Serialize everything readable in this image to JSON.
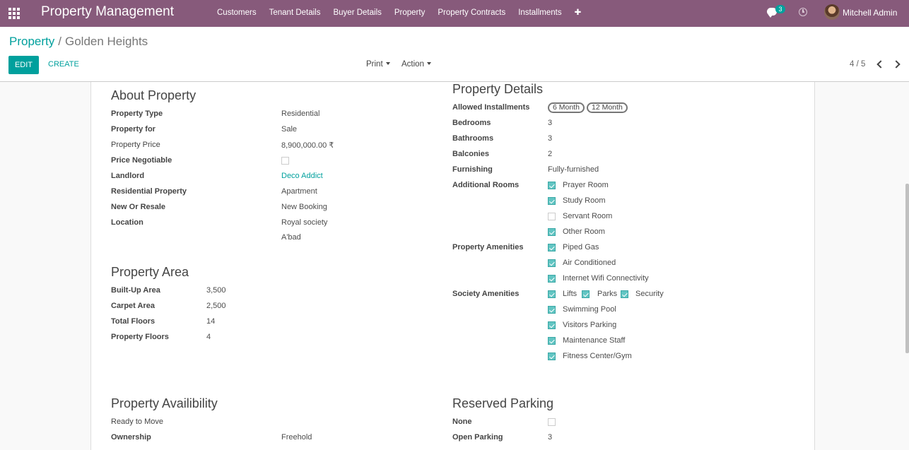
{
  "app_title": "Property Management",
  "menu": [
    "Customers",
    "Tenant Details",
    "Buyer Details",
    "Property",
    "Property Contracts",
    "Installments"
  ],
  "menu_plus": "✚",
  "messages_count": "3",
  "user_name": "Mitchell Admin",
  "colors": {
    "navbar": "#875a7b",
    "accent": "#00a09d",
    "checkbox_checked": "#62c5c3"
  },
  "breadcrumb": {
    "parent": "Property",
    "separator": "/",
    "current": "Golden Heights"
  },
  "buttons": {
    "edit": "EDIT",
    "create": "CREATE",
    "print": "Print",
    "action": "Action"
  },
  "pager": {
    "text": "4 / 5"
  },
  "about": {
    "title": "About Property",
    "fields": [
      {
        "label": "Property Type",
        "value": "Residential"
      },
      {
        "label": "Property for",
        "value": "Sale"
      },
      {
        "label": "Property Price",
        "value": "8,900,000.00 ₹"
      },
      {
        "label": "Price Negotiable",
        "checked": false
      },
      {
        "label": "Landlord",
        "value": "Deco Addict"
      },
      {
        "label": "Residential Property",
        "value": "Apartment"
      },
      {
        "label": "New Or Resale",
        "value": "New Booking"
      },
      {
        "label": "Location",
        "value": "Royal society",
        "value2": "A'bad"
      }
    ]
  },
  "area": {
    "title": "Property Area",
    "fields": [
      {
        "label": "Built-Up Area",
        "value": "3,500"
      },
      {
        "label": "Carpet Area",
        "value": "2,500"
      },
      {
        "label": "Total Floors",
        "value": "14"
      },
      {
        "label": "Property Floors",
        "value": "4"
      }
    ]
  },
  "details": {
    "title": "Property Details",
    "installments_label": "Allowed Installments",
    "installments": [
      "6 Month",
      "12 Month"
    ],
    "fields": [
      {
        "label": "Bedrooms",
        "value": "3"
      },
      {
        "label": "Bathrooms",
        "value": "3"
      },
      {
        "label": "Balconies",
        "value": "2"
      },
      {
        "label": "Furnishing",
        "value": "Fully-furnished"
      }
    ],
    "additional_rooms": {
      "label": "Additional Rooms",
      "items": [
        {
          "name": "Prayer Room",
          "checked": true
        },
        {
          "name": "Study Room",
          "checked": true
        },
        {
          "name": "Servant Room",
          "checked": false
        },
        {
          "name": "Other Room",
          "checked": true
        }
      ]
    },
    "property_amenities": {
      "label": "Property Amenities",
      "items": [
        {
          "name": "Piped Gas",
          "checked": true
        },
        {
          "name": "Air Conditioned",
          "checked": true
        },
        {
          "name": "Internet Wifi Connectivity",
          "checked": true
        }
      ]
    },
    "society_amenities": {
      "label": "Society Amenities",
      "items": [
        {
          "name": "Lifts",
          "checked": true
        },
        {
          "name": "Parks",
          "checked": true
        },
        {
          "name": "Security",
          "checked": true
        },
        {
          "name": "Swimming Pool",
          "checked": true
        },
        {
          "name": "Visitors Parking",
          "checked": true
        },
        {
          "name": "Maintenance Staff",
          "checked": true
        },
        {
          "name": "Fitness Center/Gym",
          "checked": true
        }
      ]
    }
  },
  "availability": {
    "title": "Property Availibility",
    "ready_label": "Ready to Move",
    "ownership_label": "Ownership",
    "ownership_value": "Freehold"
  },
  "parking": {
    "title": "Reserved Parking",
    "none_label": "None",
    "none_checked": false,
    "open_label": "Open Parking",
    "open_value": "3"
  }
}
